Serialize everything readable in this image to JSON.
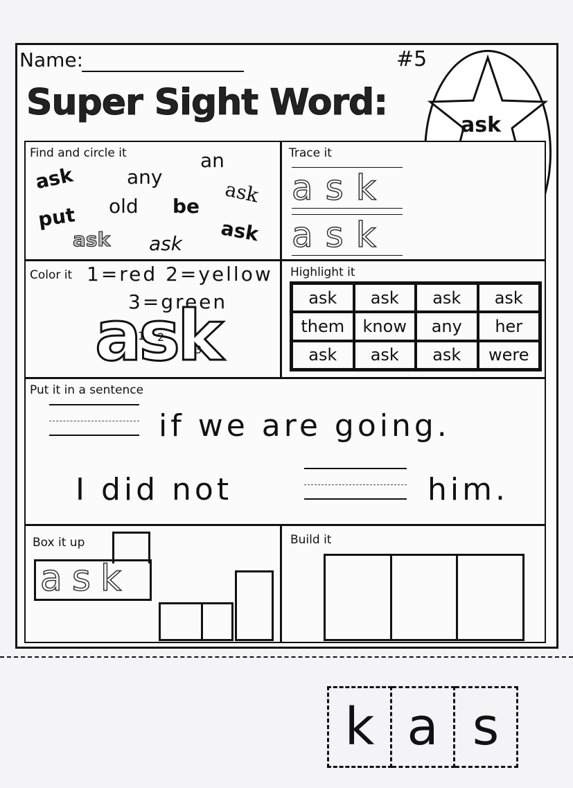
{
  "header": {
    "name_label": "Name:",
    "number": "#5",
    "title": "Super Sight Word:",
    "sight_word": "ask"
  },
  "find": {
    "label": "Find and circle it",
    "words": [
      "ask",
      "any",
      "an",
      "ask",
      "put",
      "old",
      "be",
      "ask",
      "ask",
      "ask"
    ]
  },
  "trace": {
    "label": "Trace it",
    "word": "ask"
  },
  "color": {
    "label": "Color it",
    "key_line1": "1=red 2=yellow",
    "key_line2": "3=green",
    "word": "ask",
    "numbers": [
      "1",
      "2",
      "3"
    ]
  },
  "highlight": {
    "label": "Highlight it",
    "cells": [
      "ask",
      "ask",
      "ask",
      "ask",
      "them",
      "know",
      "any",
      "her",
      "ask",
      "ask",
      "ask",
      "were"
    ]
  },
  "sentence": {
    "label": "Put it in a sentence",
    "s1": "if we are going.",
    "s2a": "I did not",
    "s2b": "him."
  },
  "boxit": {
    "label": "Box it up",
    "word": "ask"
  },
  "build": {
    "label": "Build it"
  },
  "cutout": {
    "letters": [
      "k",
      "a",
      "s"
    ]
  }
}
